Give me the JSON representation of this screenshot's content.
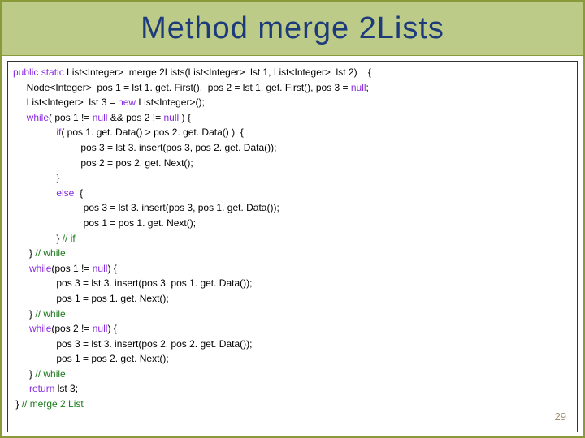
{
  "title": "Method  merge 2Lists",
  "slide_number": "29",
  "code": {
    "l1a": "public static",
    "l1b": " List<Integer>  merge 2Lists(List<Integer>  lst 1, List<Integer>  lst 2)    {",
    "l2a": "     Node<Integer>  pos 1 = lst 1. get. First(),  pos 2 = lst 1. get. First(), pos 3 = ",
    "l2null": "null",
    "l2b": ";",
    "l3a": "     List<Integer>  lst 3 = ",
    "l3new": "new",
    "l3b": " List<Integer>();",
    "l4a": "     ",
    "l4while": "while",
    "l4b": "( pos 1 != ",
    "l4n1": "null",
    "l4c": " && pos 2 != ",
    "l4n2": "null",
    "l4d": " ) {",
    "l5a": "                ",
    "l5if": "if",
    "l5b": "( pos 1. get. Data() > pos 2. get. Data() )  {",
    "l6": "                         pos 3 = lst 3. insert(pos 3, pos 2. get. Data());",
    "l7": "                         pos 2 = pos 2. get. Next();",
    "l8": "                }",
    "l9a": "                ",
    "l9else": "else",
    "l9b": "  {",
    "l10": "                          pos 3 = lst 3. insert(pos 3, pos 1. get. Data());",
    "l11": "                          pos 1 = pos 1. get. Next();",
    "l12a": "                } ",
    "l12cmt": "// if",
    "l13a": "      } ",
    "l13cmt": "// while",
    "l14a": "      ",
    "l14while": "while",
    "l14b": "(pos 1 != ",
    "l14n": "null",
    "l14c": ") {",
    "l15": "                pos 3 = lst 3. insert(pos 3, pos 1. get. Data());",
    "l16": "                pos 1 = pos 1. get. Next();",
    "l17a": "      } ",
    "l17cmt": "// while",
    "l18a": "      ",
    "l18while": "while",
    "l18b": "(pos 2 != ",
    "l18n": "null",
    "l18c": ") {",
    "l19": "                pos 3 = lst 3. insert(pos 2, pos 2. get. Data());",
    "l20": "                pos 1 = pos 2. get. Next();",
    "l21a": "      } ",
    "l21cmt": "// while",
    "l22a": "      ",
    "l22ret": "return",
    "l22b": " lst 3;",
    "l23a": " } ",
    "l23cmt": "// merge 2 List"
  }
}
